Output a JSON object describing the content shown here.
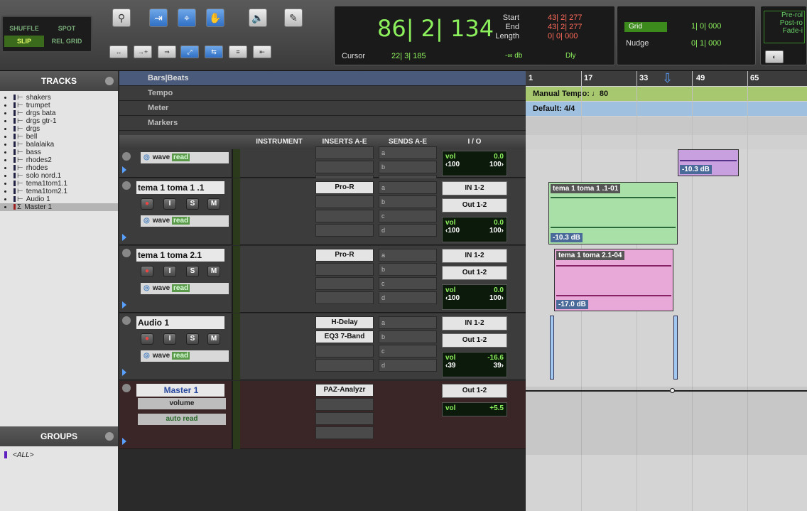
{
  "toolbar": {
    "modes": {
      "shuffle": "SHUFFLE",
      "spot": "SPOT",
      "slip": "SLIP",
      "relgrid": "REL GRID"
    },
    "counter": "86| 2| 134",
    "cursor_label": "Cursor",
    "cursor_value": "22| 3| 185",
    "start_label": "Start",
    "start_value": "43| 2| 277",
    "end_label": "End",
    "end_value": "43| 2| 277",
    "length_label": "Length",
    "length_value": "0| 0| 000",
    "db_text": "-∞ db",
    "dly_label": "Dly",
    "grid_label": "Grid",
    "grid_value": "1| 0| 000",
    "nudge_label": "Nudge",
    "nudge_value": "0| 1| 000",
    "preroll": "Pre-rol",
    "postroll": "Post-ro",
    "fadein": "Fade-i"
  },
  "tracks_panel": {
    "title": "TRACKS",
    "items": [
      "shakers",
      "trumpet",
      "drgs bata",
      "drgs gtr-1",
      "drgs",
      "bell",
      "balalaika",
      "bass",
      "rhodes2",
      "rhodes",
      "solo nord.1",
      "tema1tom1.1",
      "tema1tom2.1",
      "Audio 1",
      "Master 1"
    ]
  },
  "groups_panel": {
    "title": "GROUPS",
    "item": "<ALL>"
  },
  "rulers": {
    "barsbeats": "Bars|Beats",
    "tempo": "Tempo",
    "meter": "Meter",
    "markers": "Markers",
    "manual_tempo": "Manual Tempo:  ♩80",
    "default_meter": "Default: 4/4",
    "bars": [
      "1",
      "17",
      "33",
      "49",
      "65"
    ]
  },
  "columns": {
    "instrument": "INSTRUMENT",
    "inserts": "INSERTS A-E",
    "sends": "SENDS A-E",
    "io": "I / O"
  },
  "tracks": [
    {
      "name": "",
      "wave": "wave",
      "read": "read",
      "inserts": [
        "",
        "",
        "",
        ""
      ],
      "io_in": "",
      "io_out": "",
      "vol": "0.0",
      "pan_l": "‹100",
      "pan_r": "100›"
    },
    {
      "name": "tema 1 toma 1 .1",
      "wave": "wave",
      "read": "read",
      "inserts": [
        "Pro-R",
        "",
        "",
        ""
      ],
      "io_in": "IN 1-2",
      "io_out": "Out 1-2",
      "vol": "0.0",
      "pan_l": "‹100",
      "pan_r": "100›"
    },
    {
      "name": "tema 1 toma 2.1",
      "wave": "wave",
      "read": "read",
      "inserts": [
        "Pro-R",
        "",
        "",
        ""
      ],
      "io_in": "IN 1-2",
      "io_out": "Out 1-2",
      "vol": "0.0",
      "pan_l": "‹100",
      "pan_r": "100›"
    },
    {
      "name": "Audio 1",
      "wave": "wave",
      "read": "read",
      "inserts": [
        "H-Delay",
        "EQ3 7-Band",
        "",
        ""
      ],
      "io_in": "IN 1-2",
      "io_out": "Out 1-2",
      "vol": "-16.6",
      "pan_l": "‹39",
      "pan_r": "39›"
    },
    {
      "name": "Master 1",
      "volume": "volume",
      "auto": "auto read",
      "inserts": [
        "PAZ-Analyzr",
        "",
        "",
        ""
      ],
      "io_out": "Out 1-2",
      "vol": "+5.5"
    }
  ],
  "btn_labels": {
    "i": "I",
    "s": "S",
    "m": "M"
  },
  "vol_label": "vol",
  "sends_letters": [
    "a",
    "b",
    "c",
    "d"
  ],
  "clips": {
    "c0_db": "-10.3 dB",
    "c1_name": "tema 1 toma 1 .1-01",
    "c1_db": "-10.3 dB",
    "c2_name": "tema 1 toma 2.1-04",
    "c2_db": "-17.0 dB"
  },
  "colors": {
    "clip_green": "#a8e0a8",
    "clip_pink": "#e8a8d8",
    "clip_purple": "#c8a0e0",
    "tempo_ruler": "#a8c870",
    "meter_ruler": "#a0c0e0"
  }
}
